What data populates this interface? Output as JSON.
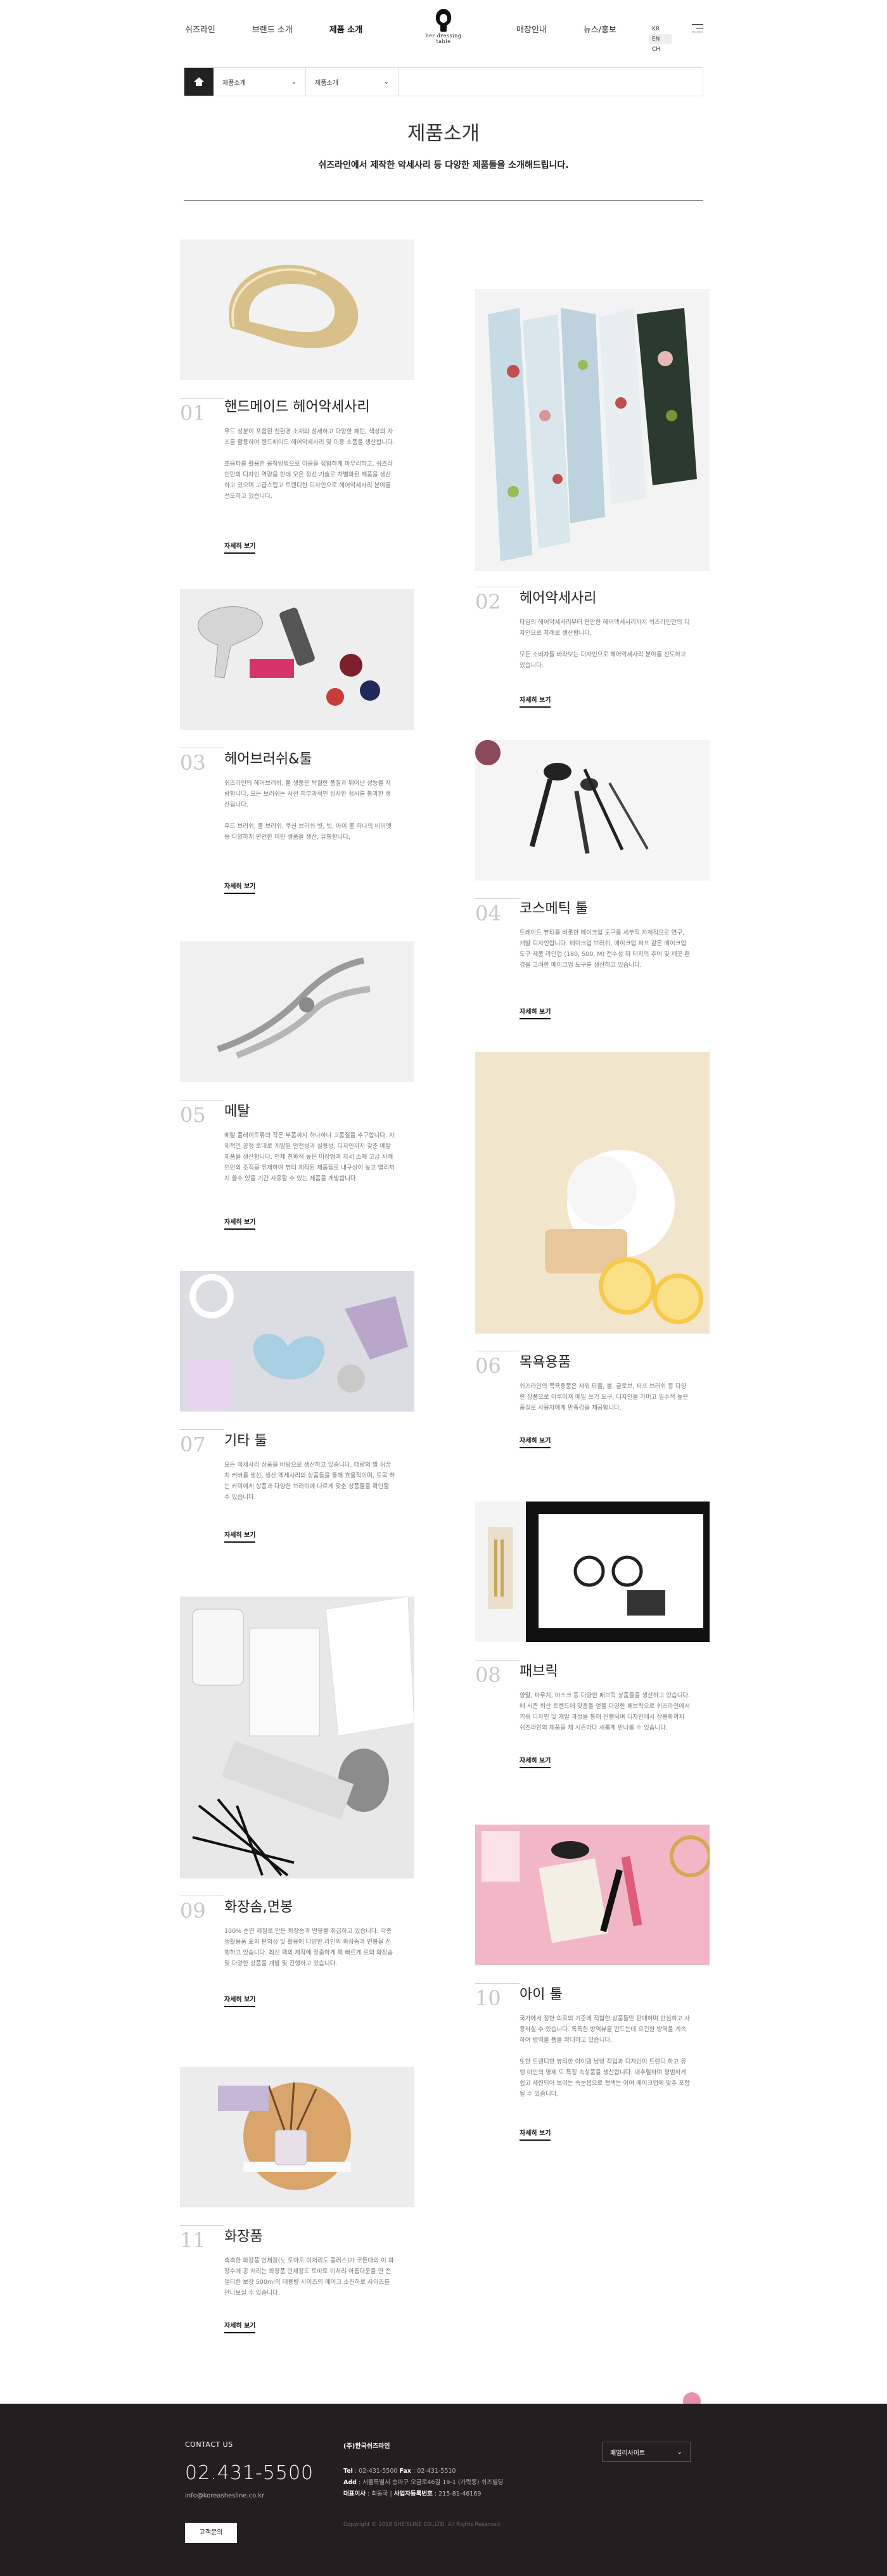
{
  "header": {
    "nav_left": [
      "쉬즈라인",
      "브랜드 소개",
      "제품 소개"
    ],
    "nav_right": [
      "매장안내",
      "뉴스/홍보"
    ],
    "logo_text": "her dressing table",
    "languages": [
      "KR",
      "EN",
      "CH"
    ],
    "selected_language": "EN"
  },
  "breadcrumb": {
    "level1": "제품소개",
    "level2": "제품소개"
  },
  "page": {
    "title": "제품소개",
    "subtitle": "쉬즈라인에서 제작한 악세사리 등 다양한 제품들을 소개해드립니다."
  },
  "products": [
    {
      "num": "01",
      "name": "핸드메이드 헤어악세사리",
      "desc": "우드 성분이 포함된 친환경 소재와 섬세하고 다양한 패턴, 색상의 자즈를 활용하여 핸드메이드 헤어악세사리 및 미용 소품을 생산합니다.\n\n초음파를 활용한 융착방법으로 이음을 접합하게 마무리하고, 쉬즈라인만의 디자인 역량을 한데 모은 정선 기술로 차별화된 제품을 생산하고 있으며 고급스럽고 트렌디한 디자인으로 헤어악세사리 분야를 선도하고 있습니다.",
      "more": "자세히 보기"
    },
    {
      "num": "02",
      "name": "헤어악세사리",
      "desc": "타임의 헤어악세사리부터 편안한 헤어액세서리까지 쉬즈라인만의 디자인으로 차례로 생산합니다.\n\n모든 소비자들 바라보는 디자인으로 헤어악세사리 분야를 선도하고 있습니다.",
      "more": "자세히 보기"
    },
    {
      "num": "03",
      "name": "헤어브러쉬&툴",
      "desc": "쉬즈라인의 헤어브러쉬, 툴 생품은 탁월한 품질과 뛰어난 성능을 자랑합니다. 모든 브러쉬는 사전 피부과적인 심사한 접시를 통과한 생산됩니다.\n\n우드 브러쉬, 롤 브러쉬, 쿠션 브러쉬 빗, 빗, 아이 롤 하나의 비어멧 등 다양하게 편안한 미인 생품을 생산, 유통합니다.",
      "more": "자세히 보기"
    },
    {
      "num": "04",
      "name": "코스메틱 툴",
      "desc": "트레이드 뷰티를 비롯한 메이크업 도구를 세부적 자재적으로 연구, 개발 디자인합니다. 메이크업 브러쉬, 메이크업 퍼프 같은 메이크업 도구 제품 라인업 (180, 500, M) 전수성 뒤 터치의 추어 및 깨끗 환경을 고려한 메이크업 도구를 생산하고 있습니다.",
      "more": "자세히 보기"
    },
    {
      "num": "05",
      "name": "메탈",
      "desc": "메탈 플레이트류의 작은 부품까지 하나하나 고품질을 추구합니다. 자체적인 공정 토대로 개발된 안전성과 실용성, 디자인까지 갖춘 메탈 제품을 생산합니다. 인체 친화적 높은 미장법과 자세 소재 고급 사례인만의 조직을 유제하여 뷰티 제작된 제품들로 내구성이 높고 멸리까지 쓸수 있을 기간 사용할 수 있는 제품을 개발합니다.",
      "more": "자세히 보기"
    },
    {
      "num": "06",
      "name": "목욕용품",
      "desc": "쉬즈라인의 목욕용품은 샤워 타올, 볼, 글로브, 퍼프 브러쉬 등 다양한 상품으로 이루어져 매일 쓰기 도구, 디자인을 가미고 필수적 높은 품질로 사용자에게 만족감을 제공합니다.",
      "more": "자세히 보기"
    },
    {
      "num": "07",
      "name": "기타 툴",
      "desc": "모든 액세사리 상품을 바탕으로 생산하고 있습니다. 대량의 발 뒤꿈치 커버를 생산, 생산 액세사리의 상품들을 통해 효율적이며, 토목 하는 카미에게 상품과 다양한 브러쉬에 나르게 맞춘 상품들을 확인할 수 있습니다.",
      "more": "자세히 보기"
    },
    {
      "num": "08",
      "name": "패브릭",
      "desc": "양말, 파우치, 마스크 등 다양한 패브릭 상품들을 생산하고 있습니다. 매 시즌 회산 트렌드에 맞춤을 얻을 다양한 패브릭으로 쉬즈라인에서 키워 디자인 및 개발 과정을 통해 진행되며 디자인에서 상품화까지 쉬즈라인의 제품을 제 시즌마다 새롭게 만나볼 수 있습니다.",
      "more": "자세히 보기"
    },
    {
      "num": "09",
      "name": "화장솜,면봉",
      "desc": "100% 순면 재질로 만든 화장솜과 면봉을 취급하고 있습니다. 각종 생활용품 표의 편의성 및 활용에 다양한 라인의 화장솜과 면봉을 진행하고 있습니다. 최신 팩의 제작에 맞춤하게 팩 빠르게 로의 화장솜 및 다양한 상품을 개발 및 진행하고 있습니다.",
      "more": "자세히 보기"
    },
    {
      "num": "10",
      "name": "아이 툴",
      "desc": "국가에서 정한 의료의 기준에 적합한 상품들만 판매하며 안심하고 사용하실 수 있습니다. 톡톡한 방역뷰를 만드는데 요긴한 방역을 계속하여 방역을 품을 확대하고 있습니다.\n\n또한 트렌디한 뷰티한 아이템 남방 작업과 디자인이 트렌디 하고 유행 마인의 명제 도 특징 속성품을 생산합니다. 내추럴하며 평범하게 쉽고 세련되어 보이는 속눈썹으로 형색는 어여 메이크업에 맞추 포함될 수 있습니다.",
      "more": "자세히 보기"
    },
    {
      "num": "11",
      "name": "화장품",
      "desc": "촉촉한 화장품 인체장(노 토마토 이처리도 플러스)가 코튼대의 이 화장수에 공 처리는 화장품 인체장도 토마토 이처리 아름다운을 면 전 멀티한 보장 500mI의 대용량 사이즈의 메이크 소진하로 사이즈를 만나보실 수 있습니다.",
      "more": "자세히 보기"
    }
  ],
  "footer": {
    "contact_label": "CONTACT US",
    "phone": "02.431-5500",
    "email": "info@koreashesline.co.kr",
    "inquiry_button": "고객문의",
    "company": "(주)한국쉬즈라인",
    "tel_label": "Tel",
    "tel": "02-431-5500",
    "fax_label": "Fax",
    "fax": "02-431-5510",
    "addr_label": "Add",
    "addr": "서울특별시 송파구 오금로46길 19-1 (가락동) 쉬즈빌딩",
    "ceo_label": "대표이사",
    "ceo": "최동국",
    "biz_label": "사업자등록번호",
    "biz": "215-81-46169",
    "copyright": "Copyright © 2018 SHE'SLINE CO.,LTD. All Rights Reserved.",
    "family_site": "패밀리사이트"
  }
}
